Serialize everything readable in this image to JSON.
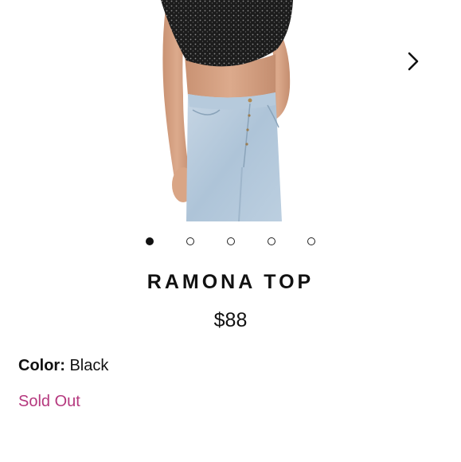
{
  "product": {
    "name": "RAMONA TOP",
    "price": "$88",
    "color_label": "Color:",
    "color_value": "Black",
    "stock_status": "Sold Out"
  },
  "carousel": {
    "total_images": 5,
    "active_index": 0,
    "next_icon": "chevron-right-icon"
  },
  "colors": {
    "text": "#111111",
    "sold_out": "#b5387e",
    "background": "#ffffff"
  }
}
